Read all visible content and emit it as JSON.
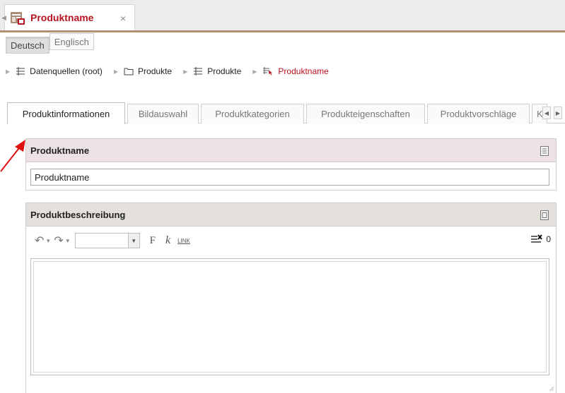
{
  "document_tab": {
    "title": "Produktname",
    "close_symbol": "×"
  },
  "languages": [
    {
      "label": "Deutsch"
    },
    {
      "label": "Englisch"
    }
  ],
  "breadcrumb": [
    {
      "label": "Datenquellen (root)"
    },
    {
      "label": "Produkte"
    },
    {
      "label": "Produkte"
    },
    {
      "label": "Produktname"
    }
  ],
  "tabs": [
    {
      "label": "Produktinformationen"
    },
    {
      "label": "Bildauswahl"
    },
    {
      "label": "Produktkategorien"
    },
    {
      "label": "Produkteigenschaften"
    },
    {
      "label": "Produktvorschläge"
    },
    {
      "label": "K"
    }
  ],
  "fields": {
    "name_panel_title": "Produktname",
    "name_value": "Produktname",
    "description_panel_title": "Produktbeschreibung"
  },
  "editor_toolbar": {
    "bold_label": "F",
    "italic_label": "k",
    "link_label": "LINK",
    "char_count": "0"
  },
  "colors": {
    "accent_red": "#b7121f",
    "tab_strip_border": "#b3906f",
    "name_header_bg": "#ece2e3",
    "description_header_bg": "#e4e0dc"
  }
}
